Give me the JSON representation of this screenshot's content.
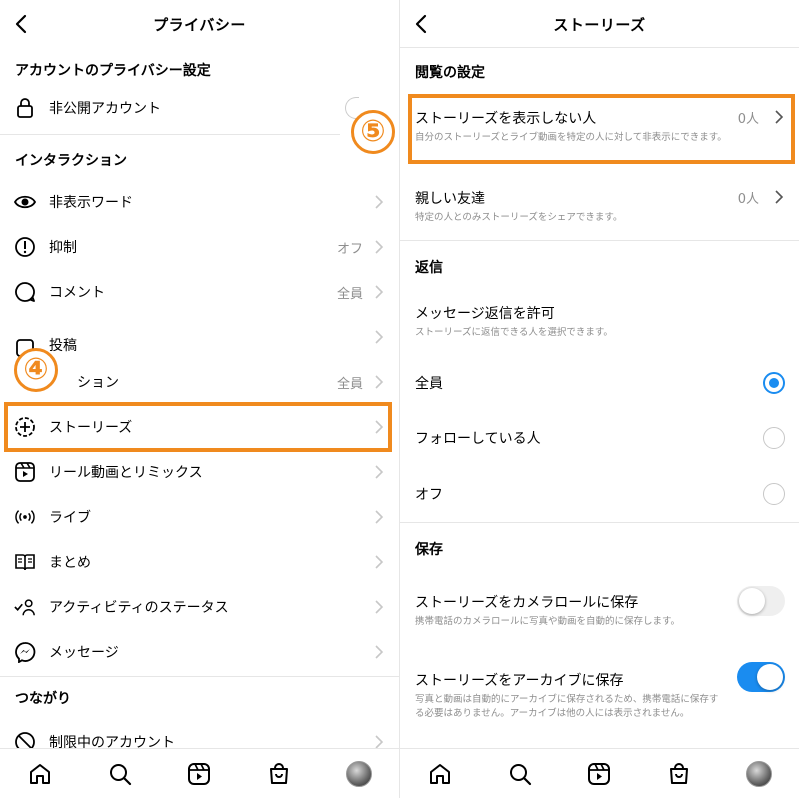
{
  "left": {
    "title": "プライバシー",
    "sections": {
      "account": "アカウントのプライバシー設定",
      "interaction": "インタラクション",
      "connections": "つながり"
    },
    "private_account": "非公開アカウント",
    "items": [
      {
        "label": "非表示ワード",
        "value": ""
      },
      {
        "label": "抑制",
        "value": "オフ"
      },
      {
        "label": "コメント",
        "value": "全員"
      },
      {
        "label": "投稿",
        "value": ""
      },
      {
        "label": "ション",
        "value": "全員"
      },
      {
        "label": "ストーリーズ",
        "value": ""
      },
      {
        "label": "リール動画とリミックス",
        "value": ""
      },
      {
        "label": "ライブ",
        "value": ""
      },
      {
        "label": "まとめ",
        "value": ""
      },
      {
        "label": "アクティビティのステータス",
        "value": ""
      },
      {
        "label": "メッセージ",
        "value": ""
      }
    ],
    "restricted": "制限中のアカウント",
    "badge": "④"
  },
  "right": {
    "title": "ストーリーズ",
    "sections": {
      "viewing": "閲覧の設定",
      "reply": "返信",
      "save": "保存"
    },
    "hide_story": {
      "title": "ストーリーズを表示しない人",
      "subtitle": "自分のストーリーズとライブ動画を特定の人に対して非表示にできます。",
      "value": "0人"
    },
    "close_friends": {
      "title": "親しい友達",
      "subtitle": "特定の人とのみストーリーズをシェアできます。",
      "value": "0人"
    },
    "message_reply": {
      "title": "メッセージ返信を許可",
      "subtitle": "ストーリーズに返信できる人を選択できます。"
    },
    "reply_options": [
      {
        "label": "全員",
        "selected": true
      },
      {
        "label": "フォローしている人",
        "selected": false
      },
      {
        "label": "オフ",
        "selected": false
      }
    ],
    "save_camera": {
      "title": "ストーリーズをカメラロールに保存",
      "subtitle": "携帯電話のカメラロールに写真や動画を自動的に保存します。",
      "on": false
    },
    "save_archive": {
      "title": "ストーリーズをアーカイブに保存",
      "subtitle": "写真と動画は自動的にアーカイブに保存されるため、携帯電話に保存する必要はありません。アーカイブは他の人には表示されません。",
      "on": true
    },
    "badge": "⑤"
  },
  "colors": {
    "highlight": "#f08a1e",
    "accent": "#1a8cf0",
    "muted": "#8e8e8e"
  },
  "tabbar_icons": [
    "home-icon",
    "search-icon",
    "reels-icon",
    "shop-icon",
    "profile-avatar"
  ]
}
